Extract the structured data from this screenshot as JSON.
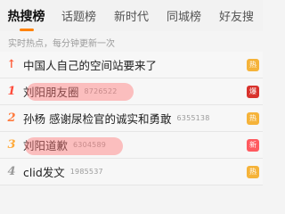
{
  "tabs": [
    "热搜榜",
    "话题榜",
    "新时代",
    "同城榜",
    "好友搜"
  ],
  "subtitle": "实时热点，每分钟更新一次",
  "items": [
    {
      "rank": "↑",
      "title": "中国人自己的空间站要来了",
      "count": "",
      "badge": "热"
    },
    {
      "rank": "1",
      "title": "刘阳朋友圈",
      "count": "8726522",
      "badge": "爆"
    },
    {
      "rank": "2",
      "title": "孙杨 感谢尿检官的诚实和勇敢",
      "count": "6355138",
      "badge": "热"
    },
    {
      "rank": "3",
      "title": "刘阳道歉",
      "count": "6304589",
      "badge": "新"
    },
    {
      "rank": "4",
      "title": "clid发文",
      "count": "1985537",
      "badge": "热"
    }
  ]
}
